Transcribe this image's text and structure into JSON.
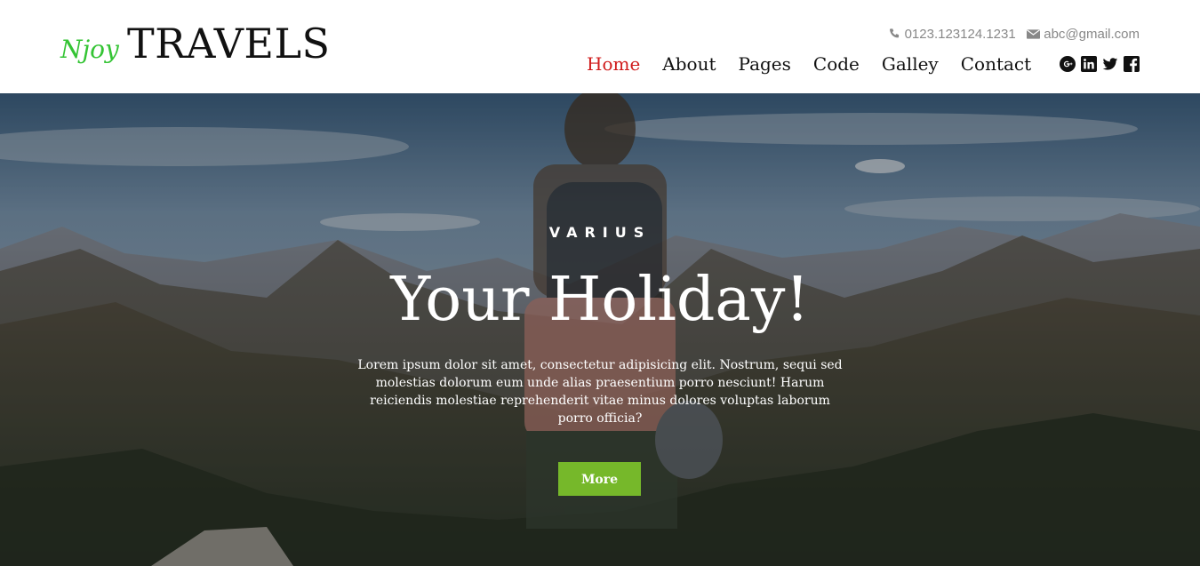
{
  "logo": {
    "prefix": "Njoy",
    "main": "TRAVELS"
  },
  "contact": {
    "phone": "0123.123124.1231",
    "email": "abc@gmail.com",
    "phone_icon": "phone-icon",
    "email_icon": "envelope-icon"
  },
  "nav": {
    "items": [
      {
        "label": "Home",
        "active": true
      },
      {
        "label": "About"
      },
      {
        "label": "Pages"
      },
      {
        "label": "Code"
      },
      {
        "label": "Galley"
      },
      {
        "label": "Contact"
      }
    ]
  },
  "social": [
    "google-plus-icon",
    "linkedin-icon",
    "twitter-icon",
    "facebook-icon"
  ],
  "hero": {
    "tagline": "VARIUS",
    "headline": "Your Holiday!",
    "description": "Lorem ipsum dolor sit amet, consectetur adipisicing elit. Nostrum, sequi sed molestias dolorum eum unde alias praesentium porro nesciunt! Harum reiciendis molestiae reprehenderit vitae minus dolores voluptas laborum porro officia?",
    "button_label": "More"
  },
  "colors": {
    "accent_green": "#76b82a",
    "logo_green": "#34c434",
    "active_red": "#d01c1c"
  }
}
